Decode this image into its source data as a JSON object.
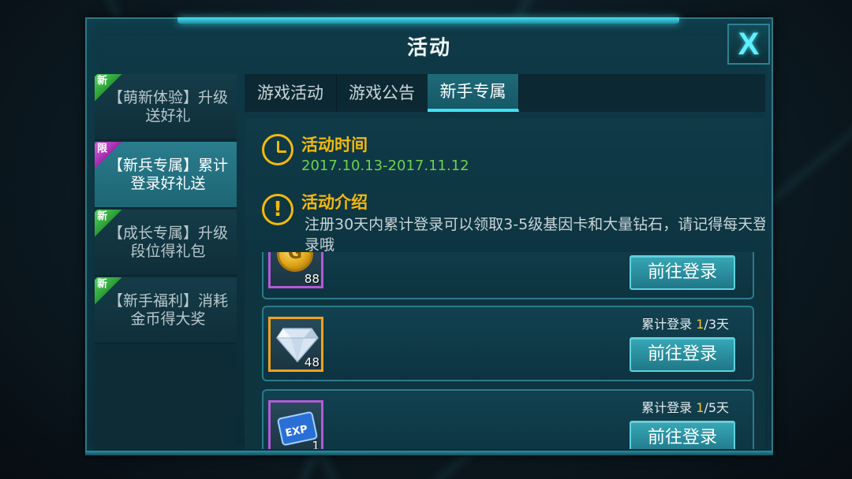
{
  "window": {
    "title": "活动",
    "close_label": "X"
  },
  "sidebar": {
    "items": [
      {
        "badge": "新",
        "badge_color": "#3fbf4a",
        "label": "【萌新体验】升级送好礼",
        "active": false
      },
      {
        "badge": "限",
        "badge_color": "#c040d0",
        "label": "【新兵专属】累计登录好礼送",
        "active": true
      },
      {
        "badge": "新",
        "badge_color": "#3fbf4a",
        "label": "【成长专属】升级段位得礼包",
        "active": false
      },
      {
        "badge": "新",
        "badge_color": "#3fbf4a",
        "label": "【新手福利】消耗金币得大奖",
        "active": false
      }
    ]
  },
  "tabs": [
    {
      "label": "游戏活动",
      "active": false
    },
    {
      "label": "游戏公告",
      "active": false
    },
    {
      "label": "新手专属",
      "active": true
    }
  ],
  "info": {
    "time_title": "活动时间",
    "time_value": "2017.10.13-2017.11.12",
    "desc_title": "活动介绍",
    "desc_text": "注册30天内累计登录可以领取3-5级基因卡和大量钻石，请记得每天登录哦"
  },
  "rewards": [
    {
      "item": "gold-coin",
      "count": "88",
      "progress_label": "",
      "button_label": "前往登录"
    },
    {
      "item": "diamond",
      "count": "48",
      "progress_prefix": "累计登录 ",
      "progress_current": "1",
      "progress_suffix": "/3天",
      "button_label": "前往登录"
    },
    {
      "item": "exp-card",
      "count": "1",
      "progress_prefix": "累计登录 ",
      "progress_current": "1",
      "progress_suffix": "/5天",
      "button_label": "前往登录"
    }
  ],
  "colors": {
    "accent_cyan": "#3fe0f2",
    "title_gold": "#f3b90b",
    "date_green": "#6ed24a",
    "badge_new": "#3fbf4a",
    "badge_limited": "#c040d0"
  }
}
